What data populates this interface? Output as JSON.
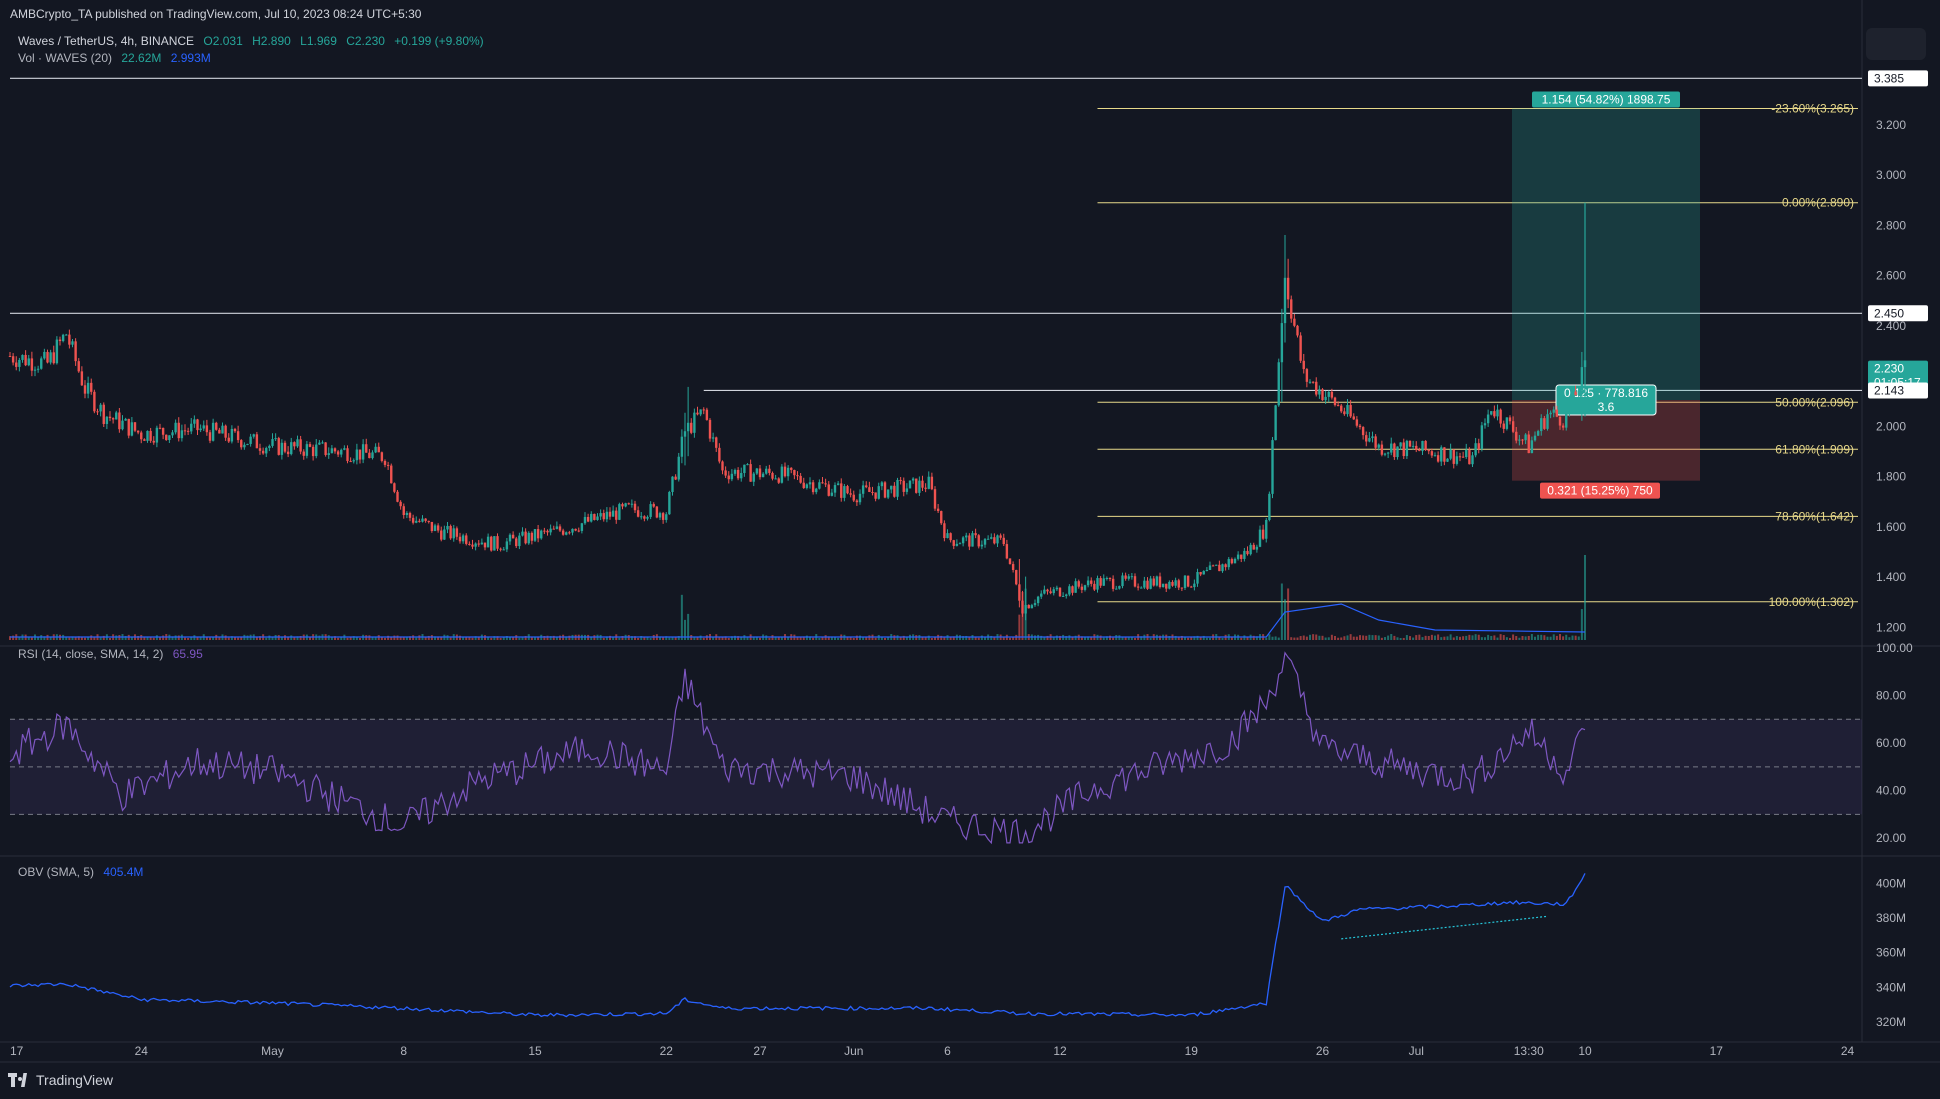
{
  "header": {
    "publisher_line": "AMBCrypto_TA published on TradingView.com, Jul 10, 2023 08:24 UTC+5:30",
    "symbol": "Waves / TetherUS, 4h, BINANCE",
    "ohlc": {
      "o": "O2.031",
      "h": "H2.890",
      "l": "L1.969",
      "c": "C2.230",
      "chg": "+0.199 (+9.80%)"
    },
    "volume_label": "Vol · WAVES (20)",
    "volume_value": "22.62M",
    "volume_ma": "2.993M",
    "rsi_label": "RSI (14, close, SMA, 14, 2)",
    "rsi_value": "65.95",
    "obv_label": "OBV (SMA, 5)",
    "obv_value": "405.4M"
  },
  "brand": {
    "name": "TradingView"
  },
  "colors": {
    "background": "#131722",
    "up": "#26a69a",
    "down": "#ef5350",
    "fib": "#e8d98a",
    "rsi": "#7e57c2",
    "obv": "#2962ff",
    "text": "#b2b5be"
  },
  "chart_data": [
    {
      "type": "candlestick",
      "ylim": [
        1.15,
        3.45
      ],
      "price_ticks": [
        "3.200",
        "3.000",
        "2.800",
        "2.600",
        "2.400",
        "2.200",
        "2.000",
        "1.800",
        "1.600",
        "1.400",
        "1.200"
      ],
      "x_ticks": [
        "17",
        "24",
        "May",
        "8",
        "15",
        "22",
        "27",
        "Jun",
        "6",
        "12",
        "19",
        "26",
        "Jul",
        "13:30",
        "10",
        "17",
        "24"
      ],
      "price_labels": [
        {
          "text": "3.385",
          "value": 3.385
        },
        {
          "text": "2.450",
          "value": 2.45
        },
        {
          "text": "2.230",
          "value": 2.23,
          "countdown": "01:05:17"
        },
        {
          "text": "2.143",
          "value": 2.143
        }
      ],
      "horizontal_lines": [
        3.385,
        2.45,
        2.143
      ],
      "fibonacci": [
        {
          "label": "-23.60%(3.265)",
          "value": 3.265
        },
        {
          "label": "0.00%(2.890)",
          "value": 2.89
        },
        {
          "label": "50.00%(2.096)",
          "value": 2.096
        },
        {
          "label": "61.80%(1.909)",
          "value": 1.909
        },
        {
          "label": "78.60%(1.642)",
          "value": 1.642
        },
        {
          "label": "100.00%(1.302)",
          "value": 1.302
        }
      ],
      "position": {
        "entry": 2.105,
        "target": 3.265,
        "stop": 1.784,
        "target_label": "1.154 (54.82%) 1898.75",
        "stop_label": "0.321 (15.25%) 750",
        "entry_label_line1": "0.125 · 778.816",
        "entry_label_line2": "3.6"
      },
      "price_path": [
        [
          "Apr 17",
          2.28
        ],
        [
          "Apr 19",
          2.25
        ],
        [
          "Apr 20",
          2.37
        ],
        [
          "Apr 21",
          2.15
        ],
        [
          "Apr 22",
          2.05
        ],
        [
          "Apr 24",
          1.97
        ],
        [
          "Apr 27",
          1.99
        ],
        [
          "May 1",
          1.92
        ],
        [
          "May 5",
          1.9
        ],
        [
          "May 7",
          1.88
        ],
        [
          "May 8",
          1.65
        ],
        [
          "May 10",
          1.58
        ],
        [
          "May 13",
          1.53
        ],
        [
          "May 16",
          1.58
        ],
        [
          "May 20",
          1.67
        ],
        [
          "May 22",
          1.66
        ],
        [
          "May 23",
          1.98
        ],
        [
          "May 24",
          2.06
        ],
        [
          "May 25",
          1.82
        ],
        [
          "May 28",
          1.81
        ],
        [
          "Jun 1",
          1.73
        ],
        [
          "Jun 5",
          1.77
        ],
        [
          "Jun 6",
          1.55
        ],
        [
          "Jun 9",
          1.54
        ],
        [
          "Jun 10",
          1.28
        ],
        [
          "Jun 11",
          1.33
        ],
        [
          "Jun 14",
          1.38
        ],
        [
          "Jun 19",
          1.38
        ],
        [
          "Jun 21",
          1.46
        ],
        [
          "Jun 22",
          1.5
        ],
        [
          "Jun 23",
          1.6
        ],
        [
          "Jun 24",
          2.6
        ],
        [
          "Jun 25",
          2.2
        ],
        [
          "Jun 27",
          2.07
        ],
        [
          "Jun 29",
          1.92
        ],
        [
          "Jul 2",
          1.9
        ],
        [
          "Jul 4",
          1.87
        ],
        [
          "Jul 5",
          2.08
        ],
        [
          "Jul 7",
          1.92
        ],
        [
          "Jul 8",
          2.05
        ],
        [
          "Jul 9",
          2.03
        ],
        [
          "Jul 10",
          2.23
        ]
      ],
      "volume_spikes": [
        "May 23",
        "Jun 10",
        "Jun 24",
        "Jul 10"
      ]
    },
    {
      "type": "line",
      "name": "RSI",
      "ylim": [
        15,
        100
      ],
      "ticks": [
        "100.00",
        "80.00",
        "60.00",
        "40.00",
        "20.00"
      ],
      "bands": [
        70,
        50,
        30
      ],
      "path": [
        [
          "Apr 17",
          55
        ],
        [
          "Apr 20",
          68
        ],
        [
          "Apr 23",
          38
        ],
        [
          "Apr 27",
          52
        ],
        [
          "May 1",
          48
        ],
        [
          "May 8",
          25
        ],
        [
          "May 12",
          44
        ],
        [
          "May 18",
          58
        ],
        [
          "May 22",
          48
        ],
        [
          "May 23",
          87
        ],
        [
          "May 25",
          50
        ],
        [
          "Jun 1",
          46
        ],
        [
          "Jun 6",
          27
        ],
        [
          "Jun 10",
          22
        ],
        [
          "Jun 14",
          42
        ],
        [
          "Jun 21",
          60
        ],
        [
          "Jun 23",
          77
        ],
        [
          "Jun 24",
          96
        ],
        [
          "Jun 26",
          58
        ],
        [
          "Jun 30",
          50
        ],
        [
          "Jul 4",
          45
        ],
        [
          "Jul 7",
          65
        ],
        [
          "Jul 9",
          48
        ],
        [
          "Jul 10",
          65.95
        ]
      ]
    },
    {
      "type": "line",
      "name": "OBV",
      "ylim": [
        312,
        410
      ],
      "ticks": [
        "400M",
        "380M",
        "360M",
        "340M",
        "320M"
      ],
      "path": [
        [
          "Apr 17",
          341
        ],
        [
          "Apr 20",
          342
        ],
        [
          "Apr 24",
          333
        ],
        [
          "May 1",
          331
        ],
        [
          "May 8",
          328
        ],
        [
          "May 15",
          324
        ],
        [
          "May 22",
          325
        ],
        [
          "May 23",
          333
        ],
        [
          "May 25",
          328
        ],
        [
          "Jun 5",
          328
        ],
        [
          "Jun 10",
          325
        ],
        [
          "Jun 19",
          324
        ],
        [
          "Jun 23",
          331
        ],
        [
          "Jun 24",
          399
        ],
        [
          "Jun 26",
          378
        ],
        [
          "Jun 28",
          385
        ],
        [
          "Jul 3",
          387
        ],
        [
          "Jul 6",
          389
        ],
        [
          "Jul 9",
          388
        ],
        [
          "Jul 10",
          405.4
        ]
      ],
      "trendline": [
        [
          "Jun 27",
          368
        ],
        [
          "Jul 8",
          381
        ]
      ]
    }
  ]
}
